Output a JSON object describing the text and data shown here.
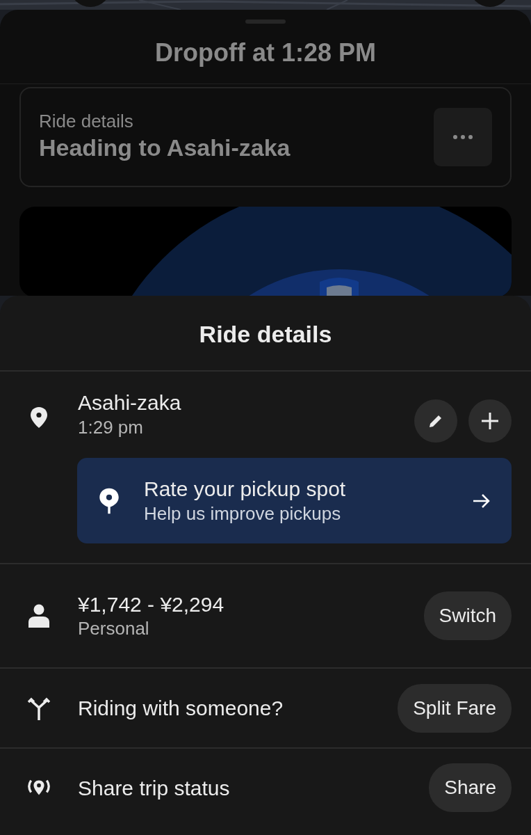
{
  "background_sheet": {
    "title": "Dropoff at 1:28 PM",
    "ride_card": {
      "label": "Ride details",
      "destination": "Heading to Asahi-zaka"
    }
  },
  "sheet": {
    "title": "Ride details",
    "stop": {
      "name": "Asahi-zaka",
      "time": "1:29 pm"
    },
    "prompt": {
      "title": "Rate your pickup spot",
      "subtitle": "Help us improve pickups"
    },
    "rows": [
      {
        "kind": "fare",
        "title": "¥1,742 - ¥2,294",
        "subtitle": "Personal",
        "action": "Switch"
      },
      {
        "kind": "split",
        "title": "Riding with someone?",
        "action": "Split Fare"
      },
      {
        "kind": "share",
        "title": "Share trip status",
        "action": "Share"
      }
    ]
  }
}
